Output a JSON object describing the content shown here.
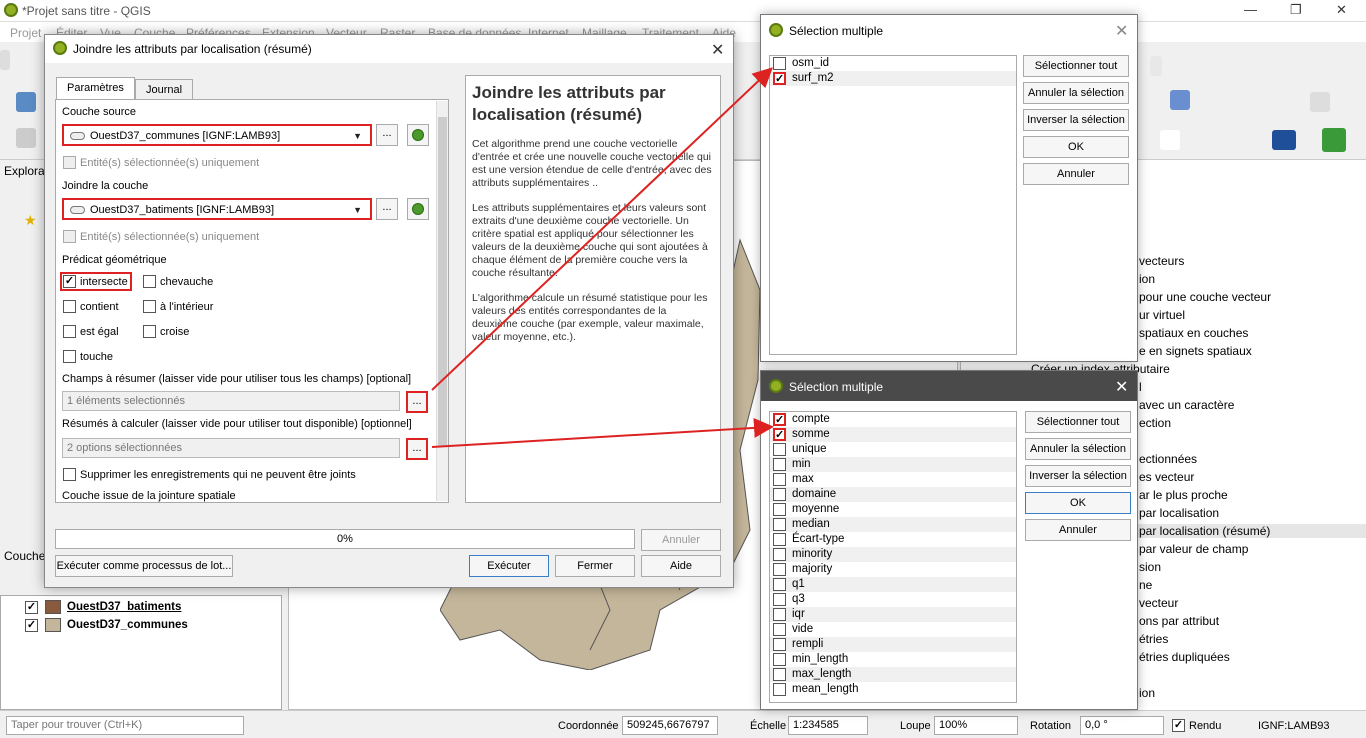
{
  "window": {
    "title": "*Projet sans titre - QGIS"
  },
  "menu": [
    "Projet",
    "Éditer",
    "Vue",
    "Couche",
    "Préférences",
    "Extension",
    "Vecteur",
    "Raster",
    "Base de données",
    "Internet",
    "Maillage",
    "Traitement",
    "Aide"
  ],
  "dialog": {
    "title": "Joindre les attributs par localisation (résumé)",
    "tabs": [
      "Paramètres",
      "Journal"
    ],
    "source_label": "Couche source",
    "source_value": "OuestD37_communes [IGNF:LAMB93]",
    "selected_only": "Entité(s) sélectionnée(s) uniquement",
    "join_label": "Joindre la couche",
    "join_value": "OuestD37_batiments [IGNF:LAMB93]",
    "predicate_label": "Prédicat géométrique",
    "predicates": [
      {
        "label": "intersecte",
        "checked": true
      },
      {
        "label": "chevauche",
        "checked": false
      },
      {
        "label": "contient",
        "checked": false
      },
      {
        "label": "à l'intérieur",
        "checked": false
      },
      {
        "label": "est égal",
        "checked": false
      },
      {
        "label": "croise",
        "checked": false
      },
      {
        "label": "touche",
        "checked": false
      }
    ],
    "fields_label": "Champs à résumer (laisser vide pour utiliser tous les champs) [optional]",
    "fields_value": "1 éléments selectionnés",
    "summaries_label": "Résumés à calculer (laisser vide pour utiliser tout disponible) [optionnel]",
    "summaries_value": "2 options sélectionnées",
    "discard_label": "Supprimer les enregistrements qui ne peuvent être joints",
    "output_label": "Couche issue de la jointure spatiale",
    "ellipsis": "...",
    "help_title": "Joindre les attributs par localisation (résumé)",
    "help_p1": "Cet algorithme prend une couche vectorielle d'entrée et crée une nouvelle couche vectorielle qui est une version étendue de celle d'entrée, avec des attributs supplémentaires ..",
    "help_p2": "Les attributs supplémentaires et leurs valeurs sont extraits d'une deuxième couche vectorielle. Un critère spatial est appliqué pour sélectionner les valeurs de la deuxième couche qui sont ajoutées à chaque élément de la première couche vers la couche résultante.",
    "help_p3": "L'algorithme calcule un résumé statistique pour les valeurs des entités correspondantes de la deuxième couche (par exemple, valeur maximale, valeur moyenne, etc.).",
    "progress": "0%",
    "cancel": "Annuler",
    "batch": "Exécuter comme processus de lot...",
    "run": "Exécuter",
    "close": "Fermer",
    "help": "Aide"
  },
  "sel1": {
    "title": "Sélection multiple",
    "items": [
      {
        "label": "osm_id",
        "checked": false
      },
      {
        "label": "surf_m2",
        "checked": true
      }
    ],
    "buttons": [
      "Sélectionner tout",
      "Annuler la sélection",
      "Inverser la sélection",
      "OK",
      "Annuler"
    ]
  },
  "sel2": {
    "title": "Sélection multiple",
    "items": [
      {
        "label": "compte",
        "checked": true
      },
      {
        "label": "somme",
        "checked": true
      },
      {
        "label": "unique",
        "checked": false
      },
      {
        "label": "min",
        "checked": false
      },
      {
        "label": "max",
        "checked": false
      },
      {
        "label": "domaine",
        "checked": false
      },
      {
        "label": "moyenne",
        "checked": false
      },
      {
        "label": "median",
        "checked": false
      },
      {
        "label": "Écart-type",
        "checked": false
      },
      {
        "label": "minority",
        "checked": false
      },
      {
        "label": "majority",
        "checked": false
      },
      {
        "label": "q1",
        "checked": false
      },
      {
        "label": "q3",
        "checked": false
      },
      {
        "label": "iqr",
        "checked": false
      },
      {
        "label": "vide",
        "checked": false
      },
      {
        "label": "rempli",
        "checked": false
      },
      {
        "label": "min_length",
        "checked": false
      },
      {
        "label": "max_length",
        "checked": false
      },
      {
        "label": "mean_length",
        "checked": false
      }
    ],
    "buttons": [
      "Sélectionner tout",
      "Annuler la sélection",
      "Inverser la sélection",
      "OK",
      "Annuler"
    ]
  },
  "leftpanel": {
    "explorer": "Explora",
    "layers_title": "Couche"
  },
  "layers": [
    {
      "name": "OuestD37_batiments",
      "color": "#8a5a3c"
    },
    {
      "name": "OuestD37_communes",
      "color": "#c4b69a"
    }
  ],
  "toolbox_items": [
    "vecteurs",
    "ion",
    "pour une couche vecteur",
    "ur virtuel",
    "spatiaux en couches",
    "e en signets spatiaux",
    "Créer un index attributaire",
    "l",
    "avec un caractère",
    "ection",
    "",
    "ectionnées",
    "es vecteur",
    "ar le plus proche",
    "par localisation",
    "par localisation (résumé)",
    "par valeur de champ",
    "sion",
    "ne",
    "vecteur",
    "ons par attribut",
    "étries",
    "étries dupliquées",
    "",
    "ion"
  ],
  "status": {
    "search_placeholder": "Taper pour trouver (Ctrl+K)",
    "coord_label": "Coordonnée",
    "coord_value": "509245,6676797",
    "scale_label": "Échelle",
    "scale_value": "1:234585",
    "zoom_label": "Loupe",
    "zoom_value": "100%",
    "rotation_label": "Rotation",
    "rotation_value": "0,0 °",
    "render_label": "Rendu",
    "crs": "IGNF:LAMB93"
  }
}
